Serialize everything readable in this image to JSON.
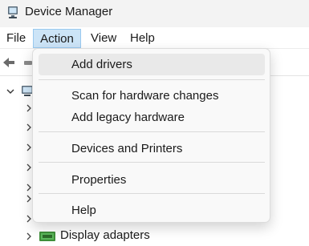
{
  "window": {
    "title": "Device Manager"
  },
  "menubar": {
    "file": "File",
    "action": "Action",
    "view": "View",
    "help": "Help"
  },
  "action_menu": {
    "items": [
      {
        "label": "Add drivers",
        "highlighted": true
      },
      {
        "label": "Scan for hardware changes"
      },
      {
        "label": "Add legacy hardware"
      },
      {
        "label": "Devices and Printers"
      },
      {
        "label": "Properties"
      },
      {
        "label": "Help"
      }
    ]
  },
  "tree": {
    "visible_leaf": {
      "label": "Display adapters",
      "icon": "display-adapter-icon"
    }
  },
  "colors": {
    "menu_active_bg": "#cce4f7",
    "menu_active_border": "#99c9ef",
    "dropdown_bg": "#f9f9f9",
    "hover_bg": "#e9e9e9"
  }
}
